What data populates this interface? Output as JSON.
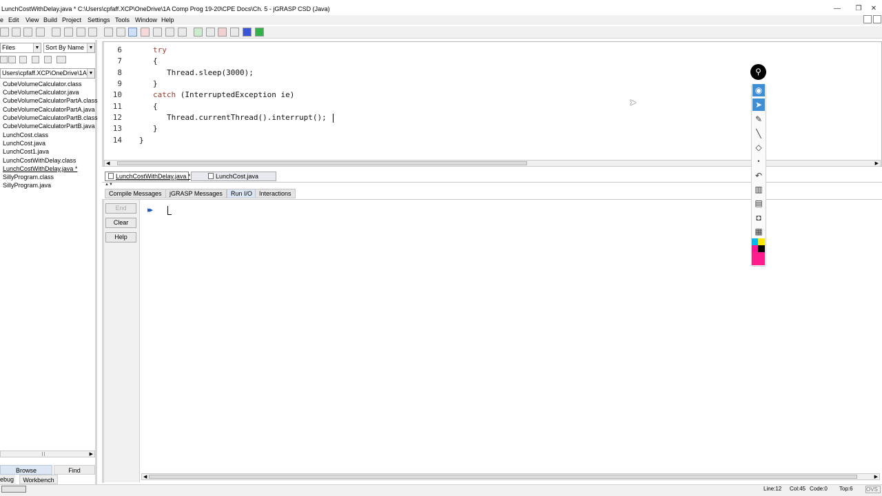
{
  "window": {
    "title": "LunchCostWithDelay.java *  C:\\Users\\cpfaff.XCP\\OneDrive\\1A Comp Prog 19-20\\CPE Docs\\Ch. 5 - jGRASP CSD (Java)",
    "minimize_glyph": "—",
    "restore_glyph": "❐",
    "close_glyph": "✕"
  },
  "menu": {
    "items": [
      {
        "label": "e"
      },
      {
        "label": "Edit"
      },
      {
        "label": "View"
      },
      {
        "label": "Build"
      },
      {
        "label": "Project"
      },
      {
        "label": "Settings"
      },
      {
        "label": "Tools"
      },
      {
        "label": "Window"
      },
      {
        "label": "Help"
      }
    ]
  },
  "left_panel": {
    "view_combo": "Files",
    "sort_combo": "Sort By Name",
    "path_combo": "Users\\cpfaff.XCP\\OneDrive\\1A Co",
    "files": [
      "CubeVolumeCalculator.class",
      "CubeVolumeCalculator.java",
      "CubeVolumeCalculatorPartA.class",
      "CubeVolumeCalculatorPartA.java",
      "CubeVolumeCalculatorPartB.class",
      "CubeVolumeCalculatorPartB.java",
      "LunchCost.class",
      "LunchCost.java",
      "LunchCost1.java",
      "LunchCostWithDelay.class",
      "LunchCostWithDelay.java *",
      "SillyProgram.class",
      "SillyProgram.java"
    ],
    "tabs": {
      "browse": "Browse",
      "find": "Find",
      "debug": "ebug",
      "workbench": "Workbench"
    }
  },
  "editor": {
    "line_numbers": [
      "6",
      "7",
      "8",
      "9",
      "10",
      "11",
      "12",
      "13",
      "14"
    ],
    "lines": {
      "l6_kw": "try",
      "l7": "{",
      "l8": "Thread.sleep(3000);",
      "l9": "}",
      "l10_kw": "catch",
      "l10_rest": " (InterruptedException ie)",
      "l11": "{",
      "l12": "Thread.currentThread().interrupt();",
      "l13": "}",
      "l14": "}"
    }
  },
  "file_tabs": [
    {
      "label": "LunchCostWithDelay.java *",
      "active": true
    },
    {
      "label": "LunchCost.java",
      "active": false
    }
  ],
  "message_tabs": [
    "Compile Messages",
    "jGRASP Messages",
    "Run I/O",
    "Interactions"
  ],
  "run_io": {
    "buttons": {
      "end": "End",
      "clear": "Clear",
      "help": "Help"
    },
    "prompt": "▸▸"
  },
  "status": {
    "line": "Line:12",
    "col": "Col:45",
    "code": "Code:0",
    "top": "Top:6",
    "ovs": "OVS"
  },
  "palette": {
    "icons": [
      "eye-icon",
      "pointer-icon",
      "pen-icon",
      "line-icon",
      "eraser-icon",
      "dot-icon",
      "undo-icon",
      "trash-icon",
      "whiteboard-icon",
      "camera-icon",
      "clipboard-icon"
    ]
  },
  "colors": {
    "keyword": "#9c3b2d",
    "palette_selected": "#3e8ed6"
  }
}
